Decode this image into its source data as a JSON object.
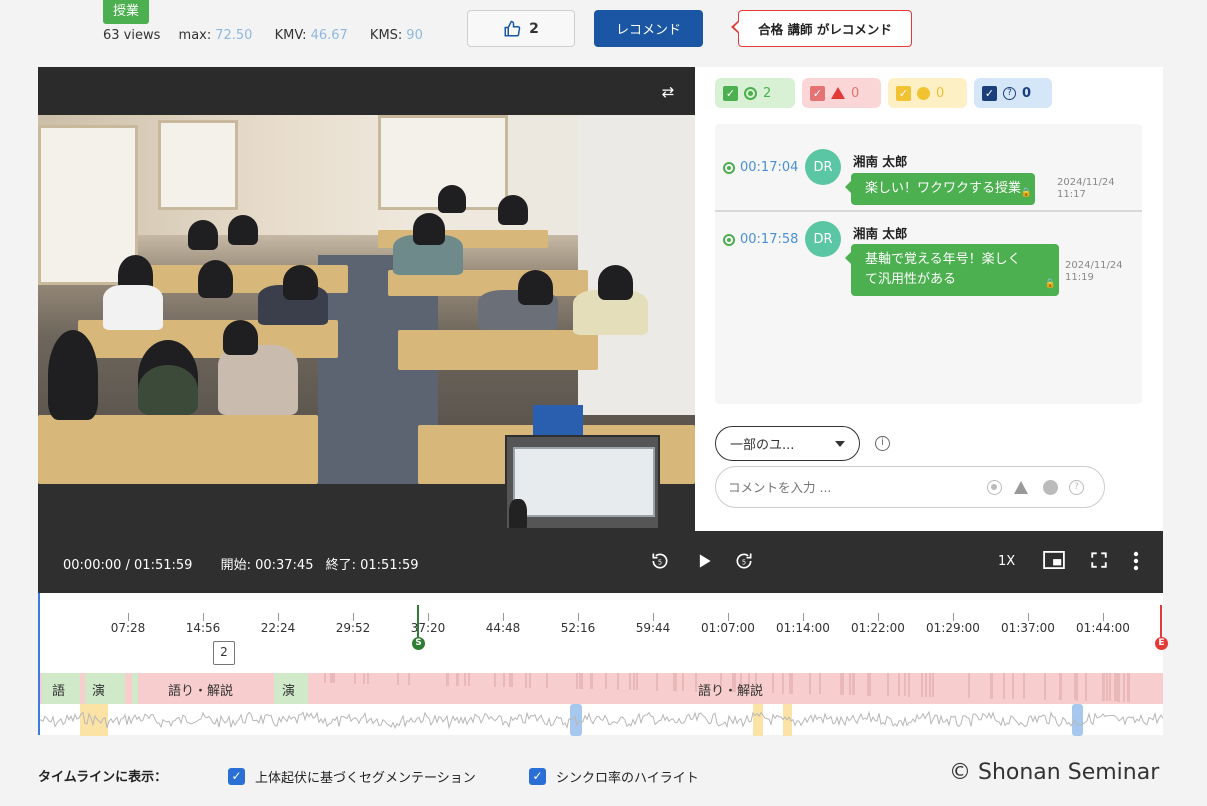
{
  "header": {
    "tag": "授業",
    "views": "63 views",
    "max_label": "max:",
    "max_value": "72.50",
    "kmv_label": "KMV:",
    "kmv_value": "46.67",
    "kms_label": "KMS:",
    "kms_value": "90",
    "like_count": "2",
    "recommend_button": "レコメンド",
    "recommend_note": "合格 講師 がレコメンド"
  },
  "filters": [
    {
      "type": "green",
      "symbol": "circle-icon",
      "count": "2",
      "color": "#4caf50"
    },
    {
      "type": "red",
      "symbol": "triangle-icon",
      "count": "0",
      "color": "#e57373"
    },
    {
      "type": "yellow",
      "symbol": "dot-icon",
      "count": "0",
      "color": "#f1c232"
    },
    {
      "type": "blue",
      "symbol": "question-icon",
      "count": "0",
      "color": "#1a3f7a"
    }
  ],
  "comments": [
    {
      "time": "00:17:04",
      "avatar": "DR",
      "name": "湘南 太郎",
      "text_lines": [
        "楽しい！ワクワクする授業"
      ],
      "date": "2024/11/24",
      "clock": "11:17"
    },
    {
      "time": "00:17:58",
      "avatar": "DR",
      "name": "湘南 太郎",
      "text_lines": [
        "基軸で覚える年号！楽しく",
        "て汎用性がある"
      ],
      "date": "2024/11/24",
      "clock": "11:19"
    }
  ],
  "comment_form": {
    "scope": "一部のユ...",
    "placeholder": "コメントを入力 ..."
  },
  "controls": {
    "time": "00:00:00 / 01:51:59",
    "start": "開始: 00:37:45",
    "end": "終了: 01:51:59",
    "speed": "1X"
  },
  "timeline": {
    "ticks": [
      "07:28",
      "14:56",
      "22:24",
      "29:52",
      "37:20",
      "44:48",
      "52:16",
      "59:44",
      "01:07:00",
      "01:14:00",
      "01:22:00",
      "01:29:00",
      "01:37:00",
      "01:44:00"
    ],
    "start_marker": "S",
    "end_marker": "E",
    "count_badge": "2",
    "segments": {
      "lecture_label": "語り・解説",
      "short_lecture_label": "語",
      "exercise_label": "演"
    }
  },
  "footer": {
    "label": "タイムラインに表示：",
    "option1": "上体起伏に基づくセグメンテーション",
    "option2": "シンクロ率のハイライト",
    "copyright": "© Shonan Seminar"
  },
  "colors": {
    "accent_blue": "#1a56a4",
    "segment_pink": "#f7cdcd",
    "segment_green": "#cfe9c9",
    "bubble_green": "#4caf50"
  }
}
